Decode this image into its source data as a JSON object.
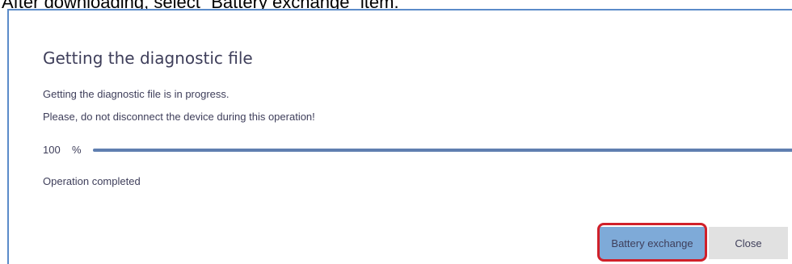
{
  "instruction": "After downloading, select “Battery exchange” item.",
  "dialog": {
    "title": "Getting the diagnostic file",
    "message_line1": "Getting the diagnostic file is in progress.",
    "message_line2": "Please, do not disconnect the device during this operation!",
    "progress": {
      "value": "100",
      "unit": "%",
      "fraction": 1.0
    },
    "status": "Operation completed",
    "buttons": {
      "battery_exchange": "Battery exchange",
      "close": "Close"
    }
  },
  "colors": {
    "accent": "#5f7fb0",
    "primary_button": "#7eaad8",
    "secondary_button": "#e1e1e1",
    "highlight": "#d0202a"
  }
}
